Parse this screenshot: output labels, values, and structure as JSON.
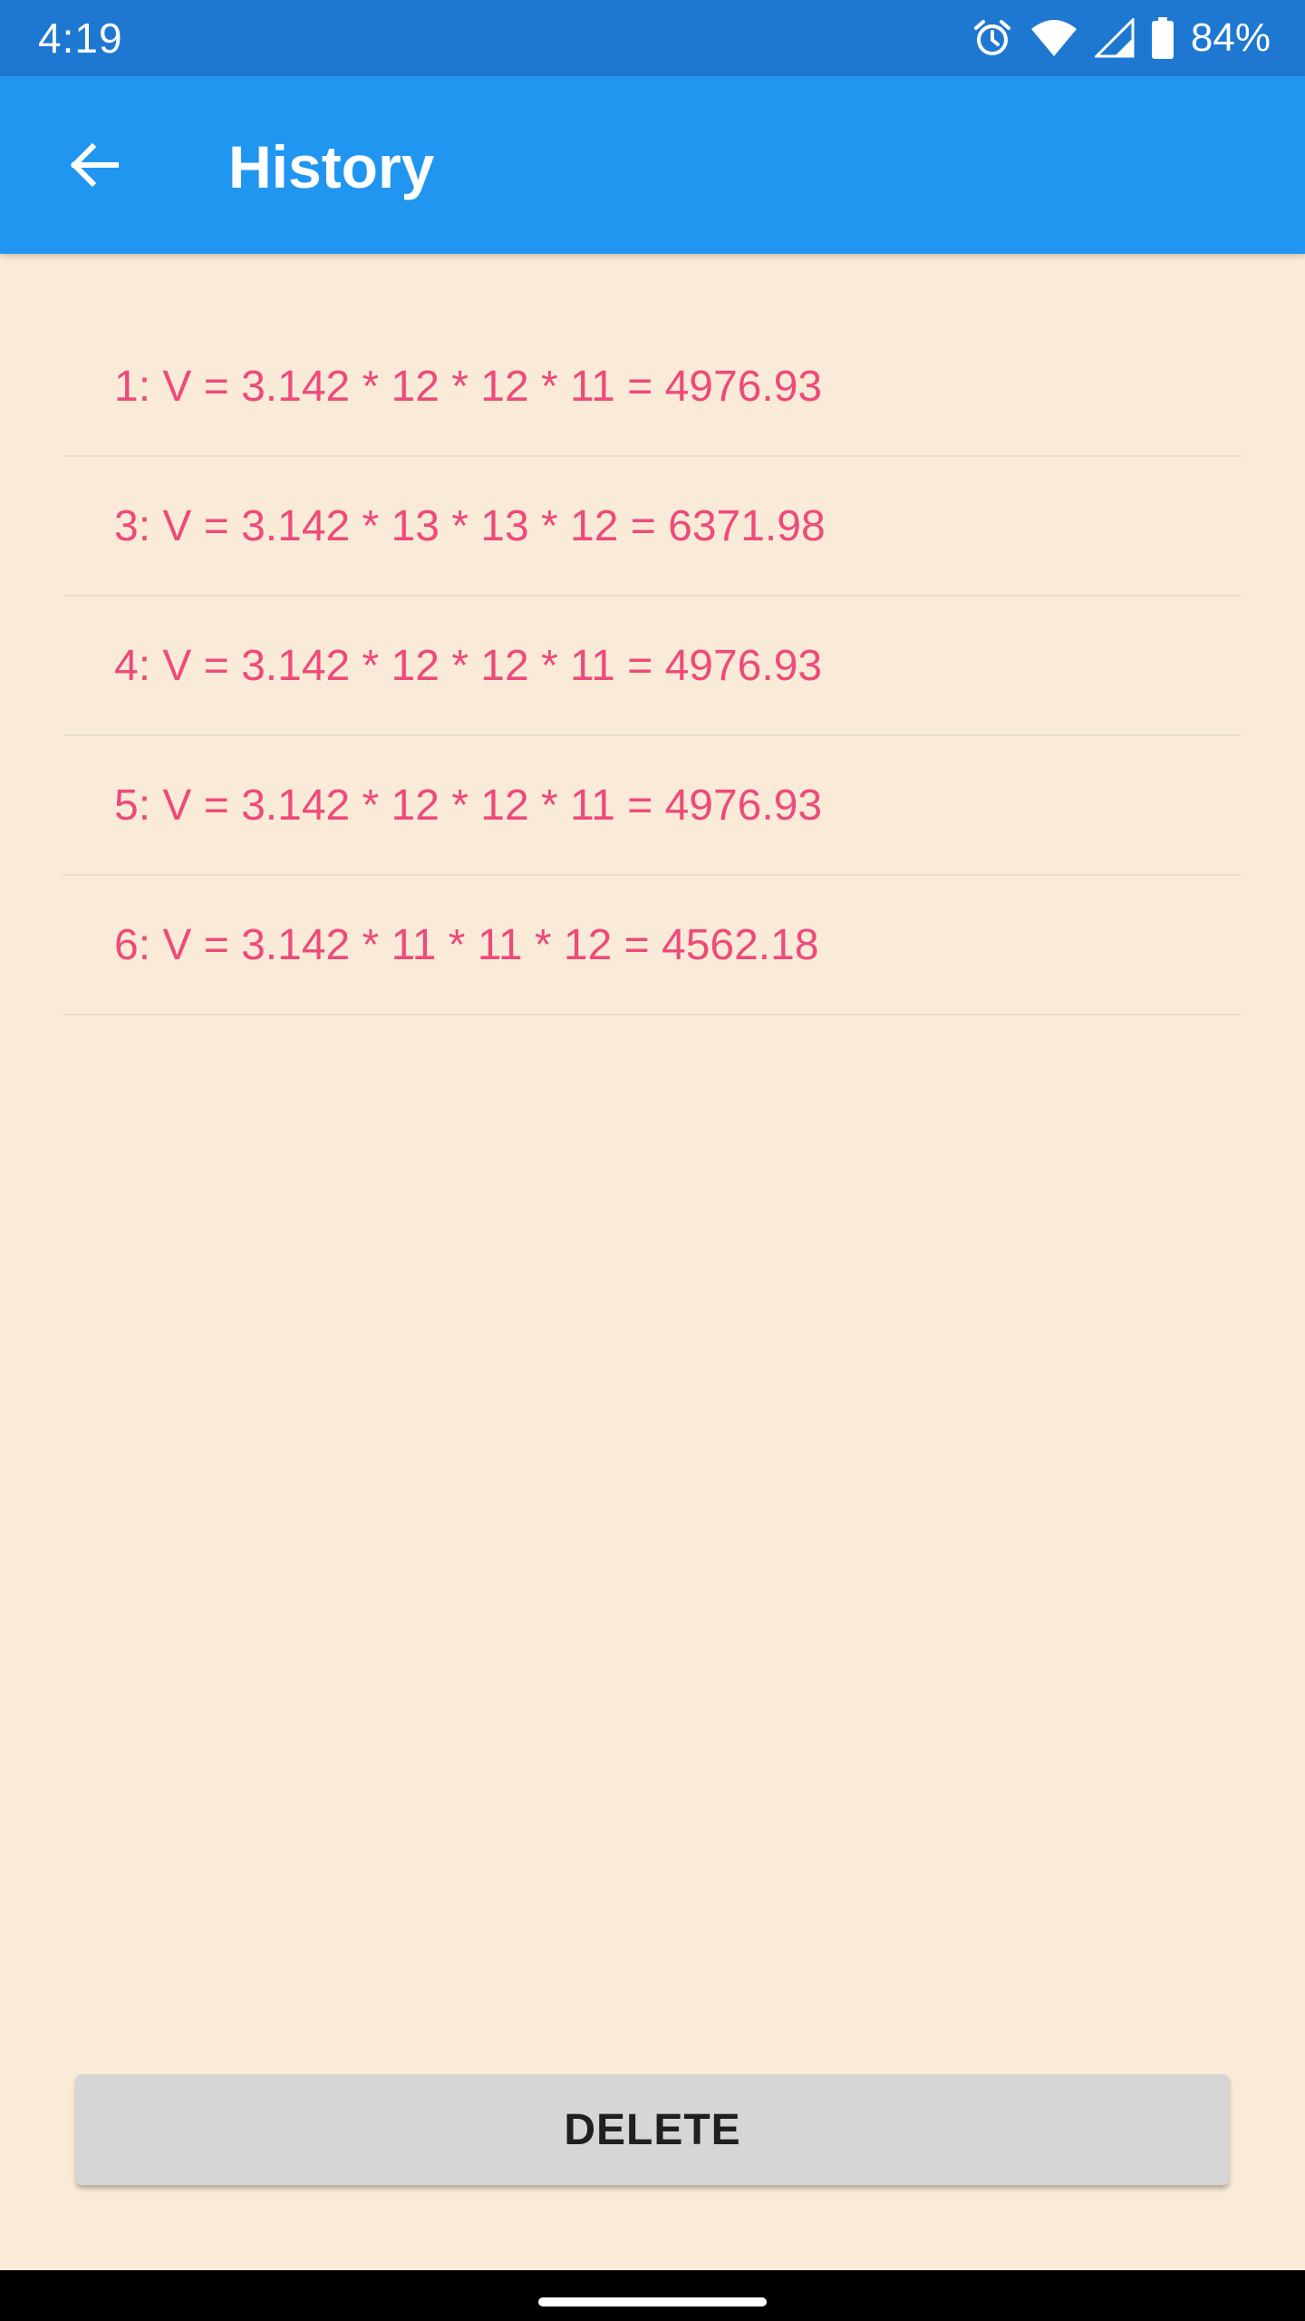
{
  "status_bar": {
    "time": "4:19",
    "battery": "84%",
    "icons": [
      "alarm-icon",
      "wifi-icon",
      "signal-icon",
      "battery-icon"
    ]
  },
  "app_bar": {
    "title": "History",
    "back_icon": "arrow-back-icon"
  },
  "history": {
    "items": [
      "1: V = 3.142 * 12 * 12 * 11 = 4976.93",
      "3: V = 3.142 * 13 * 13 * 12 = 6371.98",
      "4: V = 3.142 * 12 * 12 * 11 = 4976.93",
      "5: V = 3.142 * 12 * 12 * 11 = 4976.93",
      "6: V = 3.142 * 11 * 11 * 12 = 4562.18"
    ]
  },
  "actions": {
    "delete_label": "DELETE"
  },
  "colors": {
    "status_bar": "#1E78D2",
    "app_bar": "#2196F0",
    "background": "#FAEBD8",
    "item_text": "#EE4A7A",
    "button": "#D6D6D6"
  }
}
